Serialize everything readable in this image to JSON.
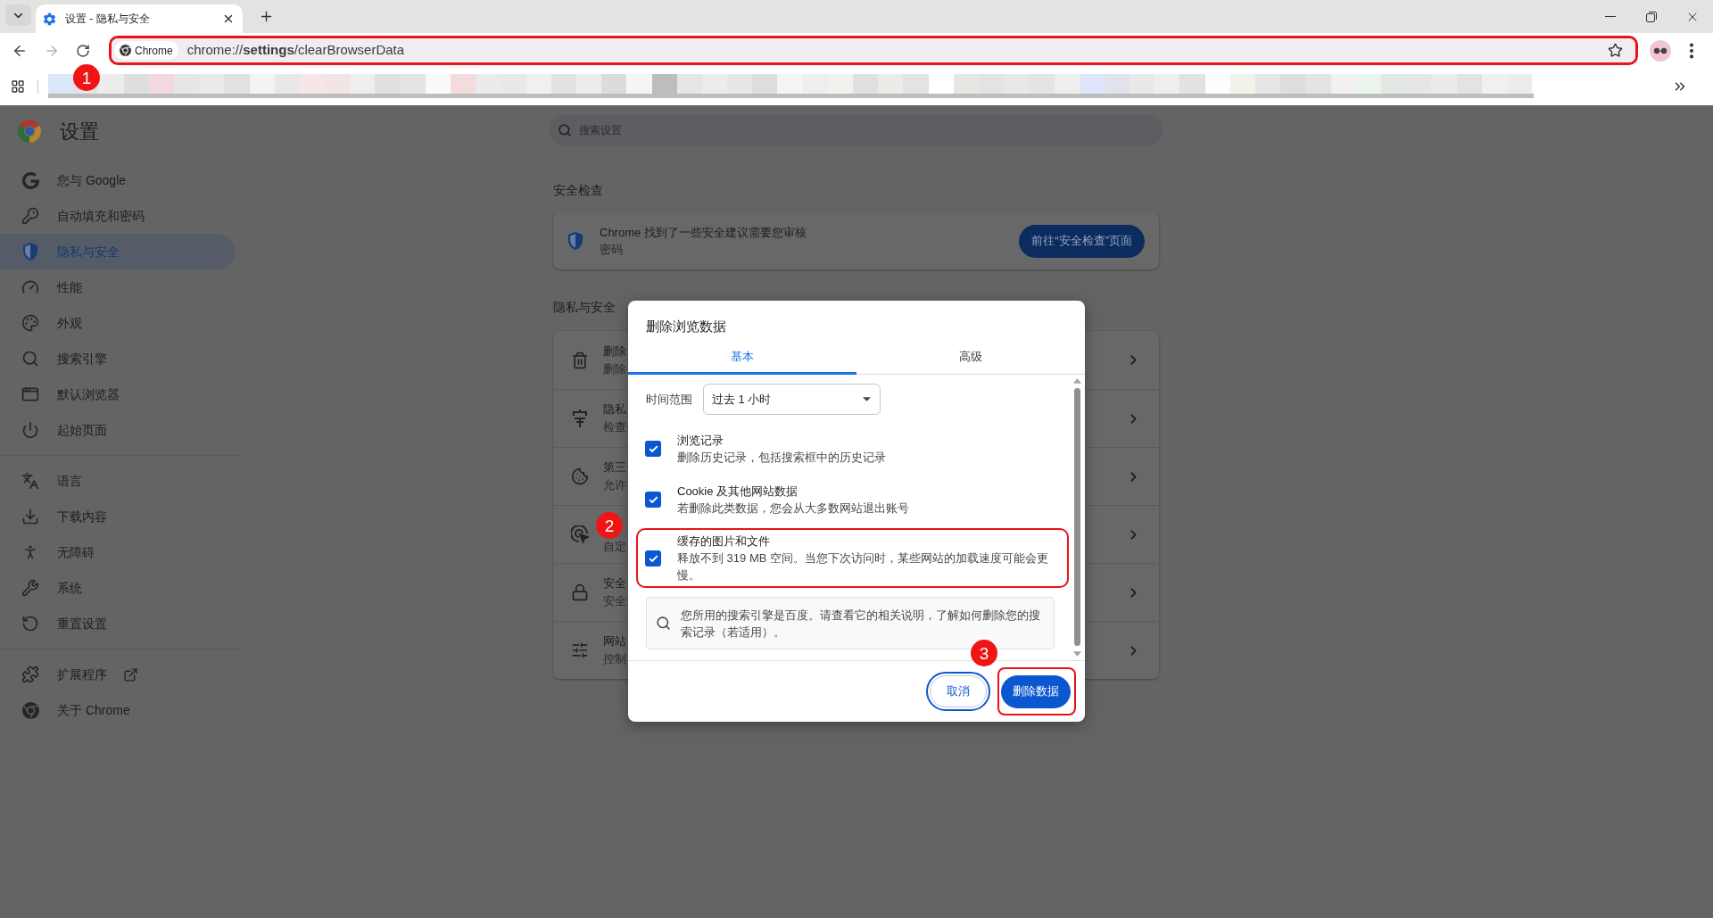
{
  "tabs": [
    {
      "title": "设置 - 隐私与安全",
      "selected": true
    }
  ],
  "toolbar": {
    "forward_disabled": true,
    "chip": "Chrome",
    "url": "chrome://**settings**/clearBrowserData",
    "highlighted": true,
    "callout": "1"
  },
  "sidebar": {
    "title": "设置",
    "groups": [
      {
        "items": [
          {
            "label": "您与 Google",
            "selected": false
          },
          {
            "label": "自动填充和密码",
            "selected": false
          },
          {
            "label": "隐私与安全",
            "selected": true
          },
          {
            "label": "性能",
            "selected": false
          },
          {
            "label": "外观",
            "selected": false
          },
          {
            "label": "搜索引擎",
            "selected": false
          },
          {
            "label": "默认浏览器",
            "selected": false
          },
          {
            "label": "起始页面",
            "selected": false
          }
        ]
      },
      {
        "items": [
          {
            "label": "语言",
            "selected": false
          },
          {
            "label": "下载内容",
            "selected": false
          },
          {
            "label": "无障碍",
            "selected": false
          },
          {
            "label": "系统",
            "selected": false
          },
          {
            "label": "重置设置",
            "selected": false
          }
        ]
      },
      {
        "items": [
          {
            "label": "扩展程序",
            "selected": false,
            "external": true
          },
          {
            "label": "关于 Chrome",
            "selected": false
          }
        ]
      }
    ]
  },
  "search": {
    "placeholder": "搜索设置"
  },
  "safety_check": {
    "heading": "安全检查",
    "message": "Chrome 找到了一些安全建议需要您审核",
    "detail": "密码",
    "button": "前往“安全检查”页面"
  },
  "privacy": {
    "heading": "隐私与安全",
    "rows": [
      {
        "title": "删除",
        "subtitle": "删除"
      },
      {
        "title": "隐私",
        "subtitle": "检查"
      },
      {
        "title": "第三",
        "subtitle": "允许"
      },
      {
        "subtitle": "自定"
      },
      {
        "title": "安全",
        "subtitle": "安全"
      },
      {
        "title": "网站",
        "subtitle": "控制"
      }
    ]
  },
  "dialog": {
    "title": "删除浏览数据",
    "tabs": [
      {
        "label": "基本",
        "selected": true
      },
      {
        "label": "高级",
        "selected": false
      }
    ],
    "time_range": {
      "label": "时间范围",
      "value": "过去 1 小时"
    },
    "options": [
      {
        "title": "浏览记录",
        "description": "删除历史记录，包括搜索框中的历史记录",
        "checked": true,
        "highlighted": false
      },
      {
        "title": "Cookie 及其他网站数据",
        "description": "若删除此类数据，您会从大多数网站退出账号",
        "checked": true,
        "highlighted": false
      },
      {
        "title": "缓存的图片和文件",
        "description": "释放不到 319 MB 空间。当您下次访问时，某些网站的加载速度可能会更慢。",
        "checked": true,
        "highlighted": true,
        "callout": "2"
      }
    ],
    "notice": "您所用的搜索引擎是百度。请查看它的相关说明，了解如何删除您的搜索记录（若适用）。",
    "buttons": [
      {
        "label": "取消",
        "kind": "secondary",
        "focused": true,
        "highlighted": false
      },
      {
        "label": "删除数据",
        "kind": "primary",
        "focused": false,
        "highlighted": true,
        "callout": "3"
      }
    ]
  }
}
